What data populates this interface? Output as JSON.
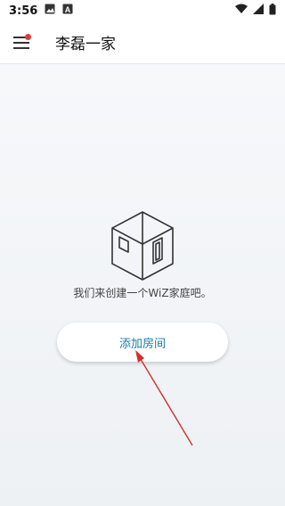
{
  "status_bar": {
    "time": "3:56",
    "icons": [
      "image-icon",
      "a-icon"
    ],
    "right_icons": [
      "wifi-icon",
      "signal-icon",
      "battery-icon"
    ]
  },
  "app_bar": {
    "title": "李磊一家",
    "menu_icon": "hamburger-menu-icon",
    "notification_color": "#e53935"
  },
  "main": {
    "empty_message": "我们来创建一个WiZ家庭吧。",
    "add_room_label": "添加房间"
  },
  "colors": {
    "accent": "#1a7ba8",
    "annotation": "#d32f2f"
  }
}
